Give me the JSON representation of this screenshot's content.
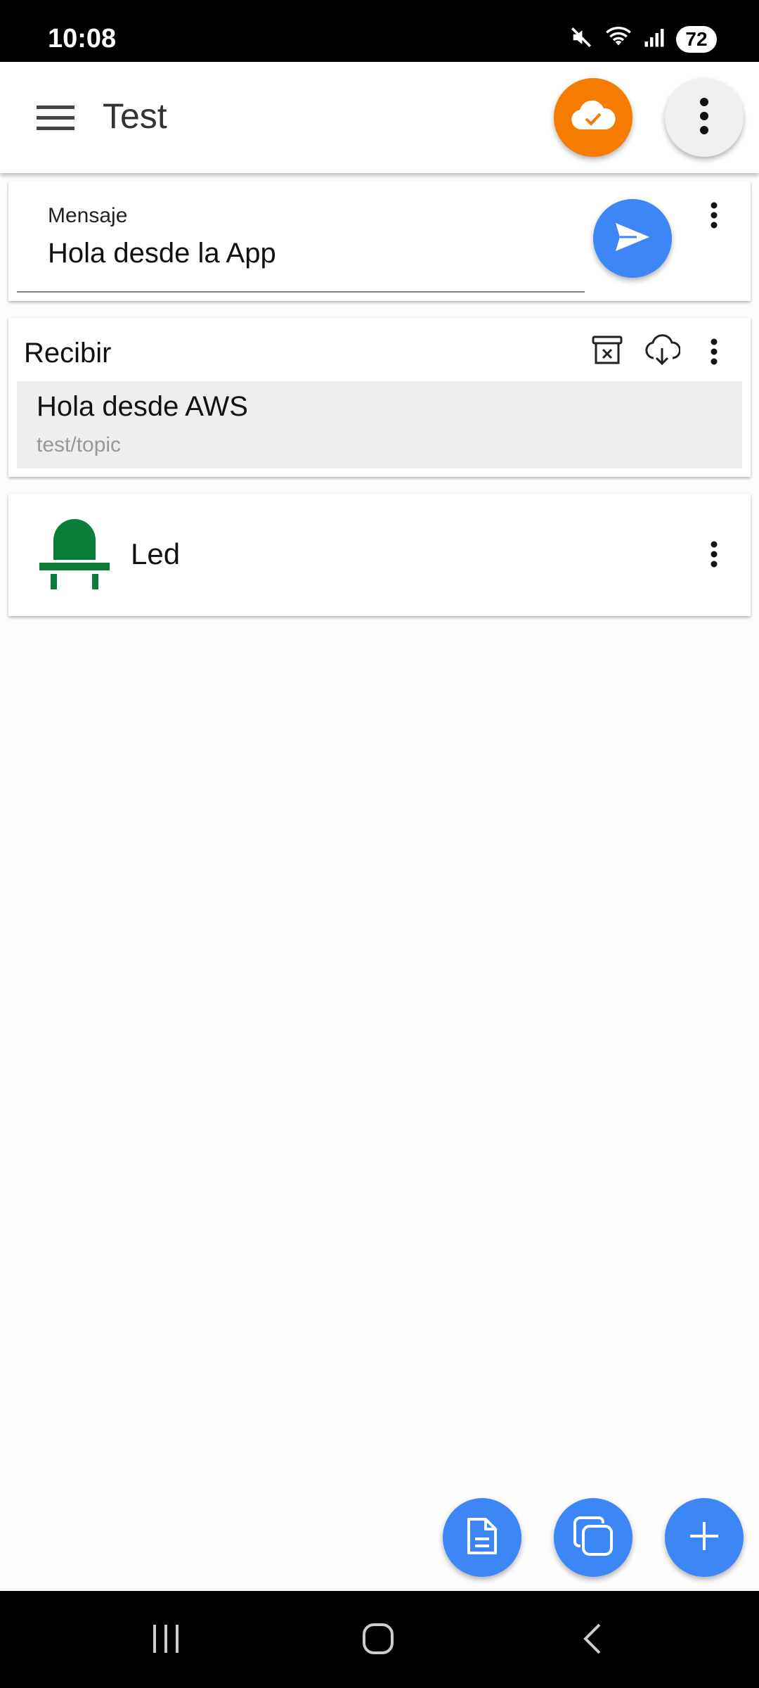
{
  "status_bar": {
    "time": "10:08",
    "battery": "72",
    "icons": [
      "mute-icon",
      "wifi-icon",
      "signal-icon",
      "battery-icon"
    ]
  },
  "app_bar": {
    "title": "Test",
    "icons": [
      "menu-icon",
      "cloud-check-icon",
      "more-vert-icon"
    ],
    "colors": {
      "cloud_button": "#f57c00",
      "menu_button": "#efefef"
    }
  },
  "send_card": {
    "label": "Mensaje",
    "value": "Hola desde la App",
    "icons": [
      "send-icon",
      "more-vert-icon"
    ]
  },
  "receive_card": {
    "title": "Recibir",
    "message": "Hola desde AWS",
    "topic": "test/topic",
    "icons": [
      "clear-archive-icon",
      "cloud-download-icon",
      "more-vert-icon"
    ]
  },
  "led_card": {
    "label": "Led",
    "icons": [
      "led-icon",
      "more-vert-icon"
    ],
    "colors": {
      "led": "#0b7d3b"
    }
  },
  "fabs": {
    "icons": [
      "document-icon",
      "copy-icon",
      "add-icon"
    ],
    "color": "#3d86f5"
  },
  "nav_bar": {
    "icons": [
      "recents-icon",
      "home-icon",
      "back-icon"
    ]
  }
}
